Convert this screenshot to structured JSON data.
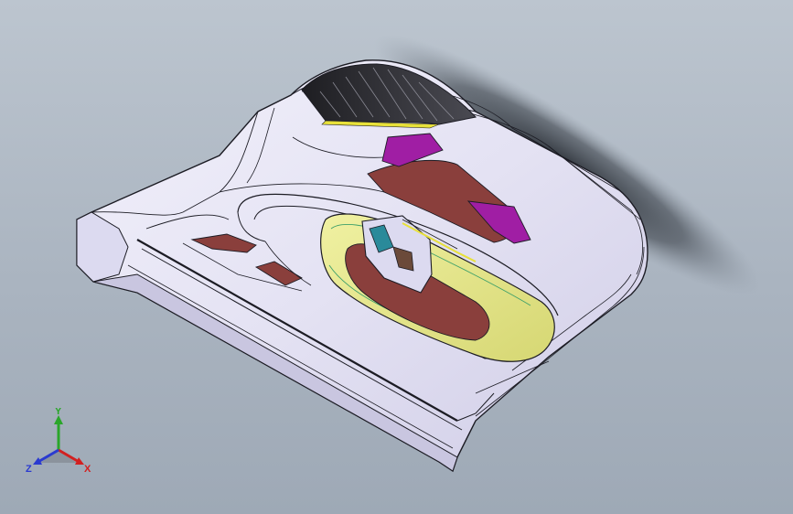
{
  "viewport": {
    "background_top": "#bcc5cf",
    "background_bottom": "#9ea9b6"
  },
  "model": {
    "surface_color": "#e6e4f4",
    "edge_color": "#1c1c24",
    "handle_color": "#e6e78c",
    "pocket_color": "#8a3f3c",
    "accent_color": "#a01ea4",
    "vent_color": "#2a2a2e",
    "vent_trim_color": "#e8e13a"
  },
  "triad": {
    "y_label": "Y",
    "x_label": "X",
    "z_label": "Z",
    "y_color": "#2aa62a",
    "x_color": "#d22020",
    "z_color": "#2a3ad0"
  }
}
